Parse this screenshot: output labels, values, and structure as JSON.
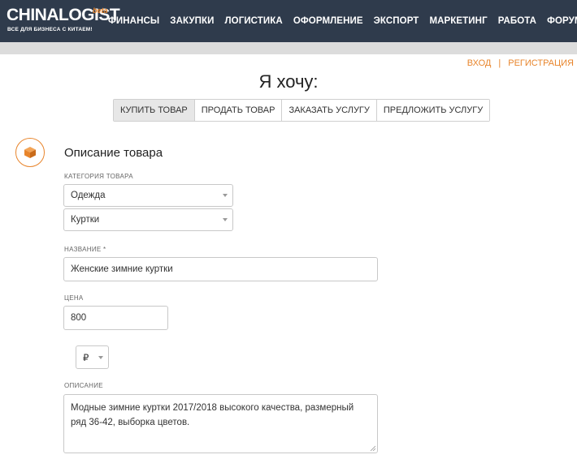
{
  "header": {
    "logo_text": "CHINALOGIST",
    "logo_beta": "beta",
    "logo_tagline": "ВСЕ ДЛЯ БИЗНЕСА С КИТАЕМ!",
    "nav": [
      "ФИНАНСЫ",
      "ЗАКУПКИ",
      "ЛОГИСТИКА",
      "ОФОРМЛЕНИЕ",
      "ЭКСПОРТ",
      "МАРКЕТИНГ",
      "РАБОТА",
      "ФОРУМ"
    ]
  },
  "auth": {
    "login": "ВХОД",
    "separator": "|",
    "register": "РЕГИСТРАЦИЯ"
  },
  "page": {
    "heading": "Я хочу:"
  },
  "tabs": [
    "КУПИТЬ ТОВАР",
    "ПРОДАТЬ ТОВАР",
    "ЗАКАЗАТЬ УСЛУГУ",
    "ПРЕДЛОЖИТЬ УСЛУГУ"
  ],
  "active_tab": "КУПИТЬ ТОВАР",
  "form": {
    "section_icon": "box-icon",
    "section_title": "Описание товара",
    "category_label": "КАТЕГОРИЯ ТОВАРА",
    "category_value": "Одежда",
    "subcategory_value": "Куртки",
    "name_label": "НАЗВАНИЕ *",
    "name_value": "Женские зимние куртки",
    "price_label": "ЦЕНА",
    "price_value": "800",
    "currency_value": "₽",
    "description_label": "ОПИСАНИЕ",
    "description_value": "Модные зимние куртки 2017/2018 высокого качества, размерный ряд 36-42, выборка цветов."
  },
  "colors": {
    "header_bg": "#2f3b4c",
    "accent": "#e8852c",
    "subbar": "#dcdcdc"
  }
}
